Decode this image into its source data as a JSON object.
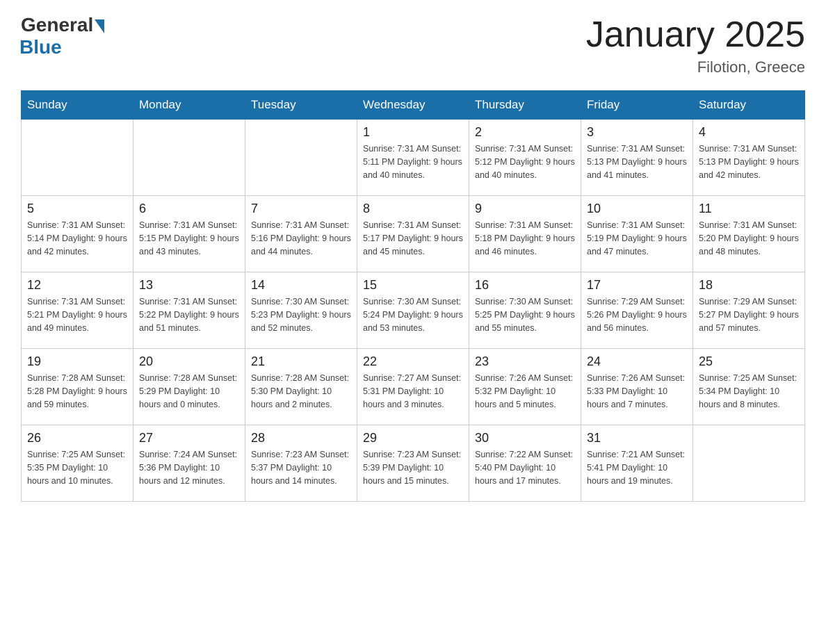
{
  "header": {
    "logo_general": "General",
    "logo_blue": "Blue",
    "title": "January 2025",
    "subtitle": "Filotion, Greece"
  },
  "days_of_week": [
    "Sunday",
    "Monday",
    "Tuesday",
    "Wednesday",
    "Thursday",
    "Friday",
    "Saturday"
  ],
  "weeks": [
    [
      {
        "day": "",
        "info": ""
      },
      {
        "day": "",
        "info": ""
      },
      {
        "day": "",
        "info": ""
      },
      {
        "day": "1",
        "info": "Sunrise: 7:31 AM\nSunset: 5:11 PM\nDaylight: 9 hours and 40 minutes."
      },
      {
        "day": "2",
        "info": "Sunrise: 7:31 AM\nSunset: 5:12 PM\nDaylight: 9 hours and 40 minutes."
      },
      {
        "day": "3",
        "info": "Sunrise: 7:31 AM\nSunset: 5:13 PM\nDaylight: 9 hours and 41 minutes."
      },
      {
        "day": "4",
        "info": "Sunrise: 7:31 AM\nSunset: 5:13 PM\nDaylight: 9 hours and 42 minutes."
      }
    ],
    [
      {
        "day": "5",
        "info": "Sunrise: 7:31 AM\nSunset: 5:14 PM\nDaylight: 9 hours and 42 minutes."
      },
      {
        "day": "6",
        "info": "Sunrise: 7:31 AM\nSunset: 5:15 PM\nDaylight: 9 hours and 43 minutes."
      },
      {
        "day": "7",
        "info": "Sunrise: 7:31 AM\nSunset: 5:16 PM\nDaylight: 9 hours and 44 minutes."
      },
      {
        "day": "8",
        "info": "Sunrise: 7:31 AM\nSunset: 5:17 PM\nDaylight: 9 hours and 45 minutes."
      },
      {
        "day": "9",
        "info": "Sunrise: 7:31 AM\nSunset: 5:18 PM\nDaylight: 9 hours and 46 minutes."
      },
      {
        "day": "10",
        "info": "Sunrise: 7:31 AM\nSunset: 5:19 PM\nDaylight: 9 hours and 47 minutes."
      },
      {
        "day": "11",
        "info": "Sunrise: 7:31 AM\nSunset: 5:20 PM\nDaylight: 9 hours and 48 minutes."
      }
    ],
    [
      {
        "day": "12",
        "info": "Sunrise: 7:31 AM\nSunset: 5:21 PM\nDaylight: 9 hours and 49 minutes."
      },
      {
        "day": "13",
        "info": "Sunrise: 7:31 AM\nSunset: 5:22 PM\nDaylight: 9 hours and 51 minutes."
      },
      {
        "day": "14",
        "info": "Sunrise: 7:30 AM\nSunset: 5:23 PM\nDaylight: 9 hours and 52 minutes."
      },
      {
        "day": "15",
        "info": "Sunrise: 7:30 AM\nSunset: 5:24 PM\nDaylight: 9 hours and 53 minutes."
      },
      {
        "day": "16",
        "info": "Sunrise: 7:30 AM\nSunset: 5:25 PM\nDaylight: 9 hours and 55 minutes."
      },
      {
        "day": "17",
        "info": "Sunrise: 7:29 AM\nSunset: 5:26 PM\nDaylight: 9 hours and 56 minutes."
      },
      {
        "day": "18",
        "info": "Sunrise: 7:29 AM\nSunset: 5:27 PM\nDaylight: 9 hours and 57 minutes."
      }
    ],
    [
      {
        "day": "19",
        "info": "Sunrise: 7:28 AM\nSunset: 5:28 PM\nDaylight: 9 hours and 59 minutes."
      },
      {
        "day": "20",
        "info": "Sunrise: 7:28 AM\nSunset: 5:29 PM\nDaylight: 10 hours and 0 minutes."
      },
      {
        "day": "21",
        "info": "Sunrise: 7:28 AM\nSunset: 5:30 PM\nDaylight: 10 hours and 2 minutes."
      },
      {
        "day": "22",
        "info": "Sunrise: 7:27 AM\nSunset: 5:31 PM\nDaylight: 10 hours and 3 minutes."
      },
      {
        "day": "23",
        "info": "Sunrise: 7:26 AM\nSunset: 5:32 PM\nDaylight: 10 hours and 5 minutes."
      },
      {
        "day": "24",
        "info": "Sunrise: 7:26 AM\nSunset: 5:33 PM\nDaylight: 10 hours and 7 minutes."
      },
      {
        "day": "25",
        "info": "Sunrise: 7:25 AM\nSunset: 5:34 PM\nDaylight: 10 hours and 8 minutes."
      }
    ],
    [
      {
        "day": "26",
        "info": "Sunrise: 7:25 AM\nSunset: 5:35 PM\nDaylight: 10 hours and 10 minutes."
      },
      {
        "day": "27",
        "info": "Sunrise: 7:24 AM\nSunset: 5:36 PM\nDaylight: 10 hours and 12 minutes."
      },
      {
        "day": "28",
        "info": "Sunrise: 7:23 AM\nSunset: 5:37 PM\nDaylight: 10 hours and 14 minutes."
      },
      {
        "day": "29",
        "info": "Sunrise: 7:23 AM\nSunset: 5:39 PM\nDaylight: 10 hours and 15 minutes."
      },
      {
        "day": "30",
        "info": "Sunrise: 7:22 AM\nSunset: 5:40 PM\nDaylight: 10 hours and 17 minutes."
      },
      {
        "day": "31",
        "info": "Sunrise: 7:21 AM\nSunset: 5:41 PM\nDaylight: 10 hours and 19 minutes."
      },
      {
        "day": "",
        "info": ""
      }
    ]
  ]
}
